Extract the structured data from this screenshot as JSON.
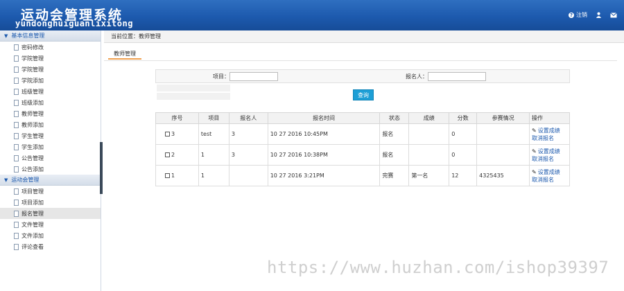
{
  "header": {
    "title": "运动会管理系统",
    "subtitle": "yundonghuiguanlixitong",
    "tools": {
      "logout_label": "注销",
      "user_icon": "user-icon",
      "mail_icon": "mail-icon"
    },
    "colors": {
      "primary": "#1d5aae"
    }
  },
  "sidebar": {
    "groups": [
      {
        "label": "基本信息管理",
        "items": [
          "密码修改",
          "学院管理",
          "学院管理",
          "学院添加",
          "班级管理",
          "班级添加",
          "教师管理",
          "教师添加",
          "学生管理",
          "学生添加",
          "公告管理",
          "公告添加"
        ]
      },
      {
        "label": "运动会管理",
        "items": [
          "项目管理",
          "项目添加",
          "报名管理",
          "文件管理",
          "文件添加",
          "评论查看"
        ]
      }
    ],
    "active_item": "报名管理"
  },
  "breadcrumb": {
    "label": "当前位置：",
    "current": "教师管理"
  },
  "tab": {
    "label": "教师管理"
  },
  "filter": {
    "project_label": "项目：",
    "project_value": "",
    "applicant_label": "报名人：",
    "applicant_value": "",
    "query_button": "查询"
  },
  "table": {
    "headers": [
      "序号",
      "项目",
      "报名人",
      "报名时间",
      "状态",
      "成绩",
      "分数",
      "参赛情况",
      "操作"
    ],
    "rows": [
      {
        "id": "3",
        "project": "test",
        "applicant": "3",
        "time": "10 27 2016 10:45PM",
        "status": "报名",
        "result": "",
        "score": "0",
        "participation": "",
        "op1": "设置成绩",
        "op2": "取消报名"
      },
      {
        "id": "2",
        "project": "1",
        "applicant": "3",
        "time": "10 27 2016 10:38PM",
        "status": "报名",
        "result": "",
        "score": "0",
        "participation": "",
        "op1": "设置成绩",
        "op2": "取消报名"
      },
      {
        "id": "1",
        "project": "1",
        "applicant": "",
        "time": "10 27 2016 3:21PM",
        "status": "完赛",
        "result": "第一名",
        "score": "12",
        "participation": "4325435",
        "op1": "设置成绩",
        "op2": "取消报名"
      }
    ]
  },
  "watermark": "https://www.huzhan.com/ishop39397"
}
